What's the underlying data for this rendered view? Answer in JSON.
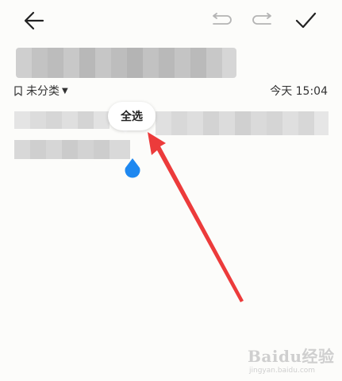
{
  "toolbar": {
    "back_icon": "back-arrow-icon",
    "undo_icon": "undo-icon",
    "redo_icon": "redo-icon",
    "confirm_icon": "check-icon"
  },
  "note": {
    "category_label": "未分类",
    "datetime": "今天 15:04"
  },
  "context_menu": {
    "select_all_label": "全选"
  },
  "colors": {
    "accent_blue": "#1e88f0",
    "annotation_red": "#ec3b3b",
    "background": "#fcfcfa"
  },
  "watermark": {
    "logo": "Baidu经验",
    "url": "jingyan.baidu.com"
  }
}
